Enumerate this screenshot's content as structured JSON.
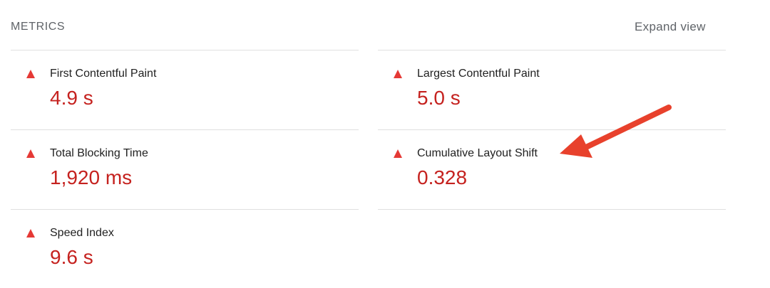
{
  "header": {
    "title": "METRICS",
    "expand_label": "Expand view"
  },
  "metrics": [
    {
      "label": "First Contentful Paint",
      "value": "4.9 s",
      "status": "fail"
    },
    {
      "label": "Largest Contentful Paint",
      "value": "5.0 s",
      "status": "fail"
    },
    {
      "label": "Total Blocking Time",
      "value": "1,920 ms",
      "status": "fail"
    },
    {
      "label": "Cumulative Layout Shift",
      "value": "0.328",
      "status": "fail"
    },
    {
      "label": "Speed Index",
      "value": "9.6 s",
      "status": "fail"
    }
  ],
  "colors": {
    "fail": "#e53935",
    "fail_value": "#c5221f",
    "annotation_arrow": "#e8412c"
  },
  "annotation": {
    "icon": "arrow-annotation-icon",
    "points_to": "Cumulative Layout Shift"
  }
}
